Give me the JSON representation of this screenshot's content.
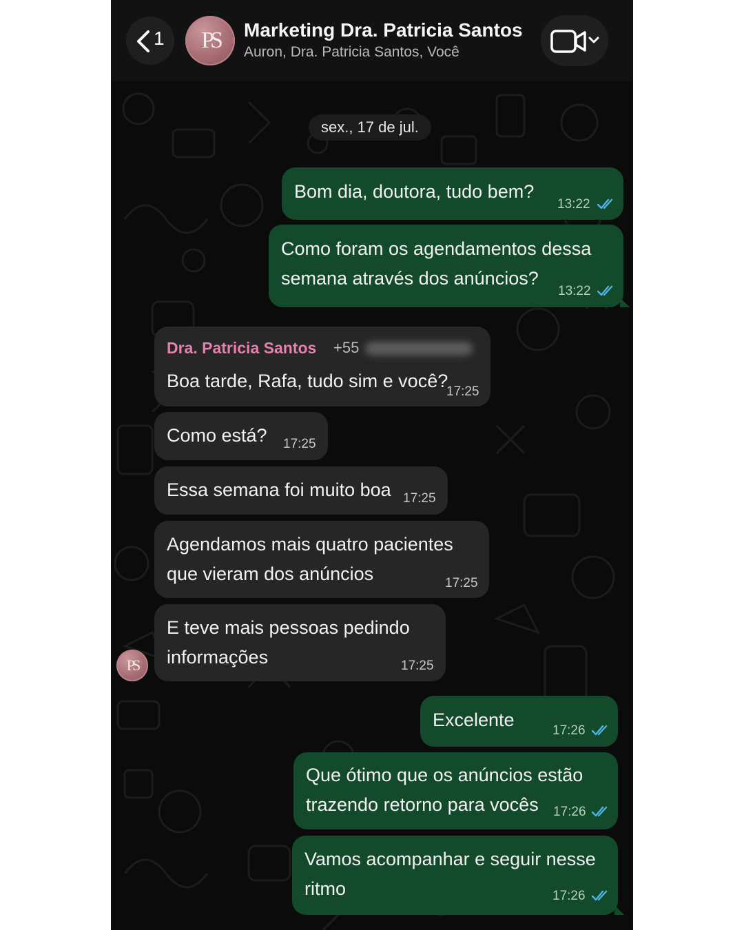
{
  "header": {
    "back_count": "1",
    "avatar_initials": "PS",
    "title": "Marketing Dra. Patricia Santos",
    "subtitle": "Auron, Dra. Patricia Santos, Você"
  },
  "date_divider": "sex., 17 de jul.",
  "messages": [
    {
      "direction": "out",
      "text": "Bom dia, doutora, tudo bem?",
      "time": "13:22",
      "status": "read"
    },
    {
      "direction": "out",
      "text": "Como foram os agendamentos dessa\nsemana através dos anúncios?",
      "time": "13:22",
      "status": "read"
    },
    {
      "direction": "in",
      "sender": "Dra. Patricia Santos",
      "sender_phone": "+55",
      "text": "Boa tarde, Rafa, tudo sim e você?",
      "time": "17:25"
    },
    {
      "direction": "in",
      "text": "Como está?",
      "time": "17:25"
    },
    {
      "direction": "in",
      "text": "Essa semana foi muito boa",
      "time": "17:25"
    },
    {
      "direction": "in",
      "text": "Agendamos mais quatro pacientes\nque vieram dos anúncios",
      "time": "17:25"
    },
    {
      "direction": "in",
      "text": "E teve mais pessoas pedindo\ninformações",
      "time": "17:25"
    },
    {
      "direction": "out",
      "text": "Excelente",
      "time": "17:26",
      "status": "read"
    },
    {
      "direction": "out",
      "text": "Que ótimo que os anúncios estão\ntrazendo retorno para vocês",
      "time": "17:26",
      "status": "read"
    },
    {
      "direction": "out",
      "text": "Vamos acompanhar e seguir nesse\nritmo",
      "time": "17:26",
      "status": "read"
    }
  ],
  "colors": {
    "background": "#0b0b0b",
    "outgoing_bubble": "#134a2c",
    "incoming_bubble": "#262626",
    "sender_name": "#e77fb0",
    "read_ticks": "#4fb3ea"
  },
  "icons": [
    "back-chevron-icon",
    "video-call-icon",
    "chevron-down-icon",
    "double-check-icon"
  ]
}
